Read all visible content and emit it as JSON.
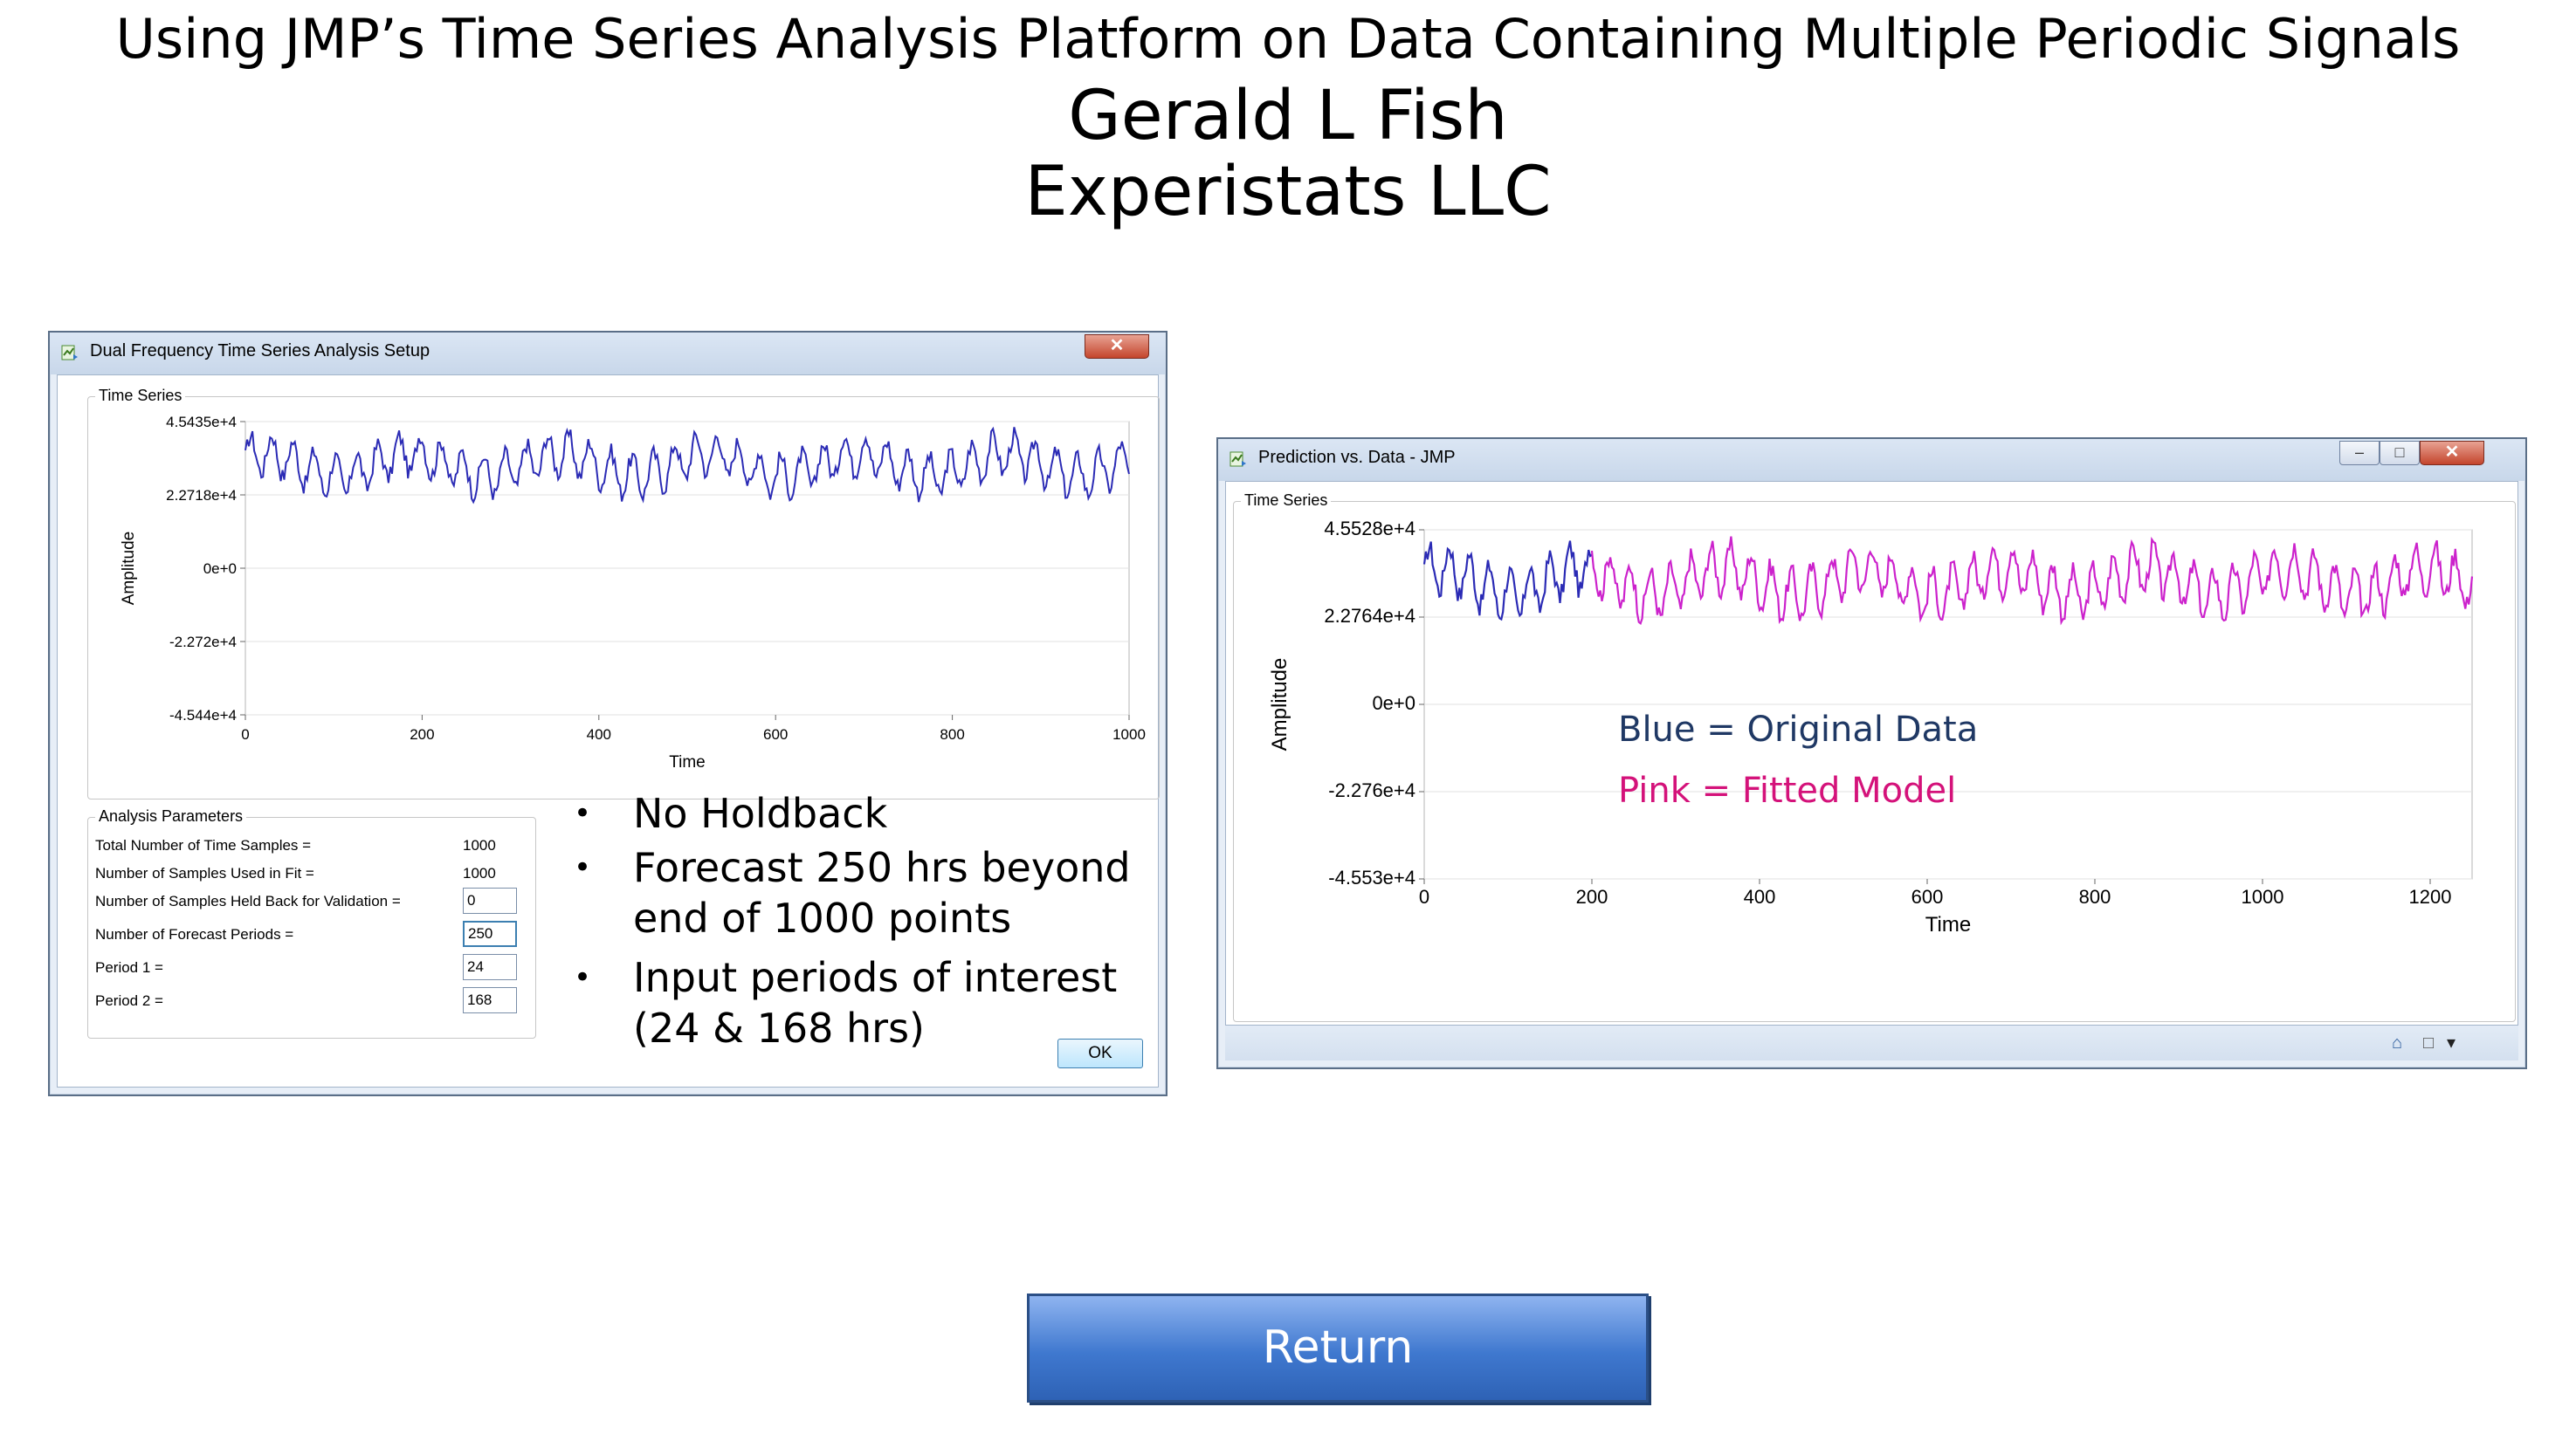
{
  "slide": {
    "title": "Using JMP’s Time Series Analysis Platform on Data Containing Multiple Periodic Signals",
    "author": "Gerald L Fish",
    "company": "Experistats LLC",
    "return_label": "Return"
  },
  "setup_window": {
    "title": "Dual Frequency Time Series Analysis Setup",
    "close_glyph": "✕",
    "group_time_series": "Time Series",
    "group_params": "Analysis Parameters",
    "ok_label": "OK",
    "params": [
      {
        "label": "Total Number of Time Samples =",
        "value": "1000"
      },
      {
        "label": "Number of Samples Used in Fit =",
        "value": "1000"
      },
      {
        "label": "Number of Samples Held Back for Validation =",
        "value": "0"
      },
      {
        "label": "Number of Forecast Periods =",
        "value": "250"
      },
      {
        "label": "Period 1 =",
        "value": "24"
      },
      {
        "label": "Period 2 =",
        "value": "168"
      }
    ],
    "bullets": [
      {
        "dot": "•",
        "lines": [
          "No Holdback"
        ]
      },
      {
        "dot": "•",
        "lines": [
          "Forecast 250 hrs beyond",
          "end of 1000 points"
        ]
      },
      {
        "dot": "•",
        "lines": [
          "Input periods of interest",
          "(24 & 168 hrs)"
        ]
      }
    ]
  },
  "prediction_window": {
    "title": "Prediction vs. Data - JMP",
    "close_glyph": "✕",
    "min_glyph": "–",
    "max_glyph": "□",
    "group_time_series": "Time Series",
    "legend_blue": "Blue = Original Data",
    "legend_pink": "Pink = Fitted Model",
    "status_icons": [
      "home-icon",
      "checkbox-icon",
      "dropdown-arrow-icon"
    ]
  },
  "colors": {
    "original_data": "#2b2bb5",
    "fitted_model": "#cc22cc",
    "legend_blue_text": "#1f3864",
    "legend_pink_text": "#d4127a",
    "accent": "#3c7fb1"
  },
  "chart_data": [
    {
      "type": "line",
      "title": "",
      "xlabel": "Time",
      "ylabel": "Amplitude",
      "xlim": [
        0,
        1000
      ],
      "ylim": [
        -45435,
        45435
      ],
      "xticks": [
        "0",
        "200",
        "400",
        "600",
        "800",
        "1000"
      ],
      "yticks": [
        "4.5435e+4",
        "2.2718e+4",
        "0e+0",
        "-2.272e+4",
        "-4.544e+4"
      ],
      "grid": "horizontal",
      "series": [
        {
          "color": "#2b2bb5",
          "x_range": [
            0,
            1000
          ],
          "baseline": 32000,
          "amp1": 6000,
          "period1": 24,
          "amp2": 3500,
          "period2": 168
        }
      ]
    },
    {
      "type": "line",
      "title": "",
      "xlabel": "Time",
      "ylabel": "Amplitude",
      "xlim": [
        0,
        1250
      ],
      "ylim": [
        -45530,
        45528
      ],
      "xticks": [
        "0",
        "200",
        "400",
        "600",
        "800",
        "1000",
        "1200"
      ],
      "yticks": [
        "4.5528e+4",
        "2.2764e+4",
        "0e+0",
        "-2.276e+4",
        "-4.553e+4"
      ],
      "grid": "horizontal",
      "series": [
        {
          "name": "Original Data",
          "color": "#2b2bb5",
          "x_range": [
            0,
            200
          ],
          "baseline": 32000,
          "amp1": 6000,
          "period1": 24,
          "amp2": 3500,
          "period2": 168
        },
        {
          "name": "Fitted Model",
          "color": "#cc22cc",
          "x_range": [
            200,
            1250
          ],
          "baseline": 32000,
          "amp1": 6000,
          "period1": 24,
          "amp2": 3500,
          "period2": 168
        }
      ]
    }
  ]
}
